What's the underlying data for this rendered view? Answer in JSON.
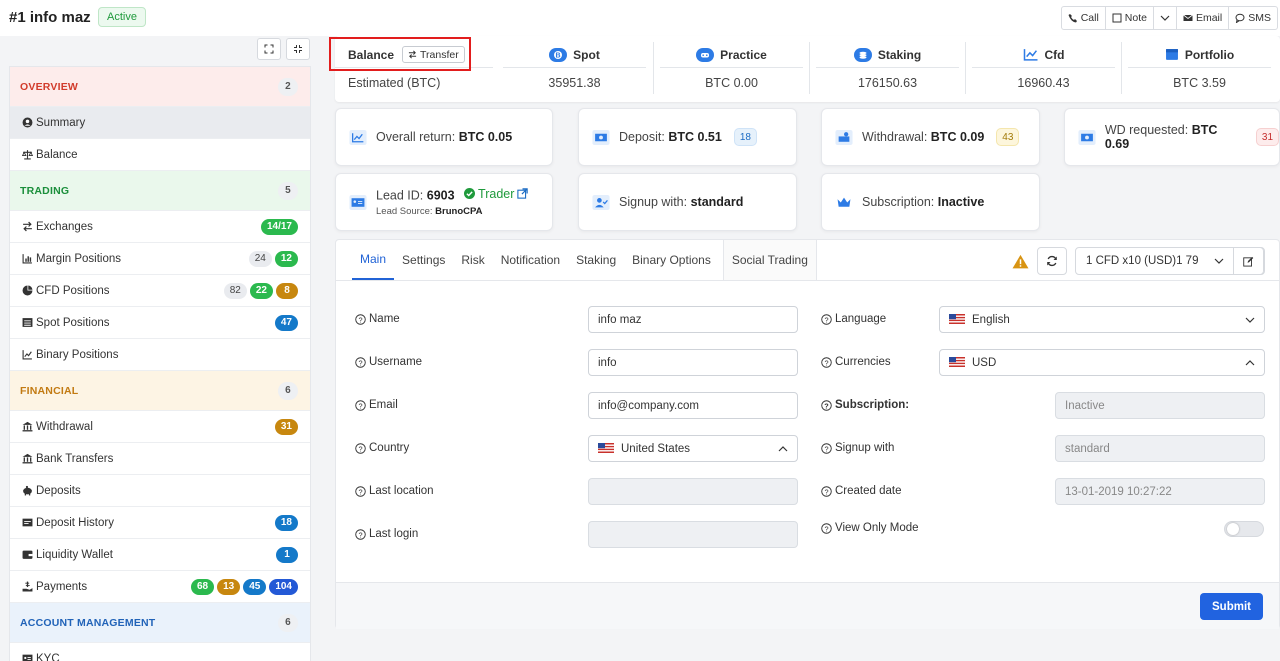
{
  "header": {
    "user_title": "#1 info maz",
    "status": "Active",
    "contact": {
      "call": "Call",
      "note": "Note",
      "email": "Email",
      "sms": "SMS"
    }
  },
  "sidebar": {
    "sections": [
      {
        "title": "OVERVIEW",
        "count": "2"
      },
      {
        "title": "TRADING",
        "count": "5"
      },
      {
        "title": "FINANCIAL",
        "count": "6"
      },
      {
        "title": "ACCOUNT MANAGEMENT",
        "count": "6"
      }
    ],
    "overview": [
      {
        "label": "Summary"
      },
      {
        "label": "Balance"
      }
    ],
    "trading": [
      {
        "label": "Exchanges",
        "badges": [
          "14/17"
        ]
      },
      {
        "label": "Margin Positions",
        "badges": [
          "24",
          "12"
        ]
      },
      {
        "label": "CFD Positions",
        "badges": [
          "82",
          "22",
          "8"
        ]
      },
      {
        "label": "Spot Positions",
        "badges": [
          "47"
        ]
      },
      {
        "label": "Binary Positions",
        "badges": []
      }
    ],
    "financial": [
      {
        "label": "Withdrawal",
        "badges": [
          "31"
        ]
      },
      {
        "label": "Bank Transfers",
        "badges": []
      },
      {
        "label": "Deposits",
        "badges": []
      },
      {
        "label": "Deposit History",
        "badges": [
          "18"
        ]
      },
      {
        "label": "Liquidity Wallet",
        "badges": [
          "1"
        ]
      },
      {
        "label": "Payments",
        "badges": [
          "68",
          "13",
          "45",
          "104"
        ]
      }
    ],
    "account": [
      {
        "label": "KYC"
      }
    ]
  },
  "balance": {
    "title": "Balance",
    "transfer": "Transfer",
    "estimated": "Estimated (BTC)",
    "columns": [
      {
        "label": "Spot",
        "value": "35951.38"
      },
      {
        "label": "Practice",
        "value": "BTC 0.00"
      },
      {
        "label": "Staking",
        "value": "176150.63"
      },
      {
        "label": "Cfd",
        "value": "16960.43"
      },
      {
        "label": "Portfolio",
        "value": "BTC 3.59"
      }
    ]
  },
  "cards": {
    "overall_label": "Overall return:",
    "overall_value": "BTC 0.05",
    "deposit_label": "Deposit:",
    "deposit_value": "BTC 0.51",
    "deposit_count": "18",
    "withdrawal_label": "Withdrawal:",
    "withdrawal_value": "BTC 0.09",
    "withdrawal_count": "43",
    "wd_label": "WD requested:",
    "wd_value": "BTC 0.69",
    "wd_count": "31",
    "lead_label": "Lead ID:",
    "lead_value": "6903",
    "trader": "Trader",
    "lead_source_label": "Lead Source:",
    "lead_source_value": "BrunoCPA",
    "signup_label": "Signup with:",
    "signup_value": "standard",
    "subscription_label": "Subscription:",
    "subscription_value": "Inactive"
  },
  "tabs": [
    "Main",
    "Settings",
    "Risk",
    "Notification",
    "Staking",
    "Binary Options",
    "Social Trading"
  ],
  "account_select": "1 CFD x10 (USD)1 79",
  "form": {
    "name_label": "Name",
    "name_value": "info maz",
    "username_label": "Username",
    "username_value": "info",
    "email_label": "Email",
    "email_value": "info@company.com",
    "country_label": "Country",
    "country_value": "United States",
    "last_location_label": "Last location",
    "last_login_label": "Last login",
    "language_label": "Language",
    "language_value": "English",
    "currencies_label": "Currencies",
    "currencies_value": "USD",
    "subscription_label": "Subscription:",
    "subscription_value": "Inactive",
    "signup_label": "Signup with",
    "signup_value": "standard",
    "created_label": "Created date",
    "created_value": "13-01-2019 10:27:22",
    "view_only_label": "View Only Mode"
  },
  "submit_label": "Submit",
  "colors": {
    "accent": "#2163e0",
    "highlight": "#e21d1d"
  }
}
